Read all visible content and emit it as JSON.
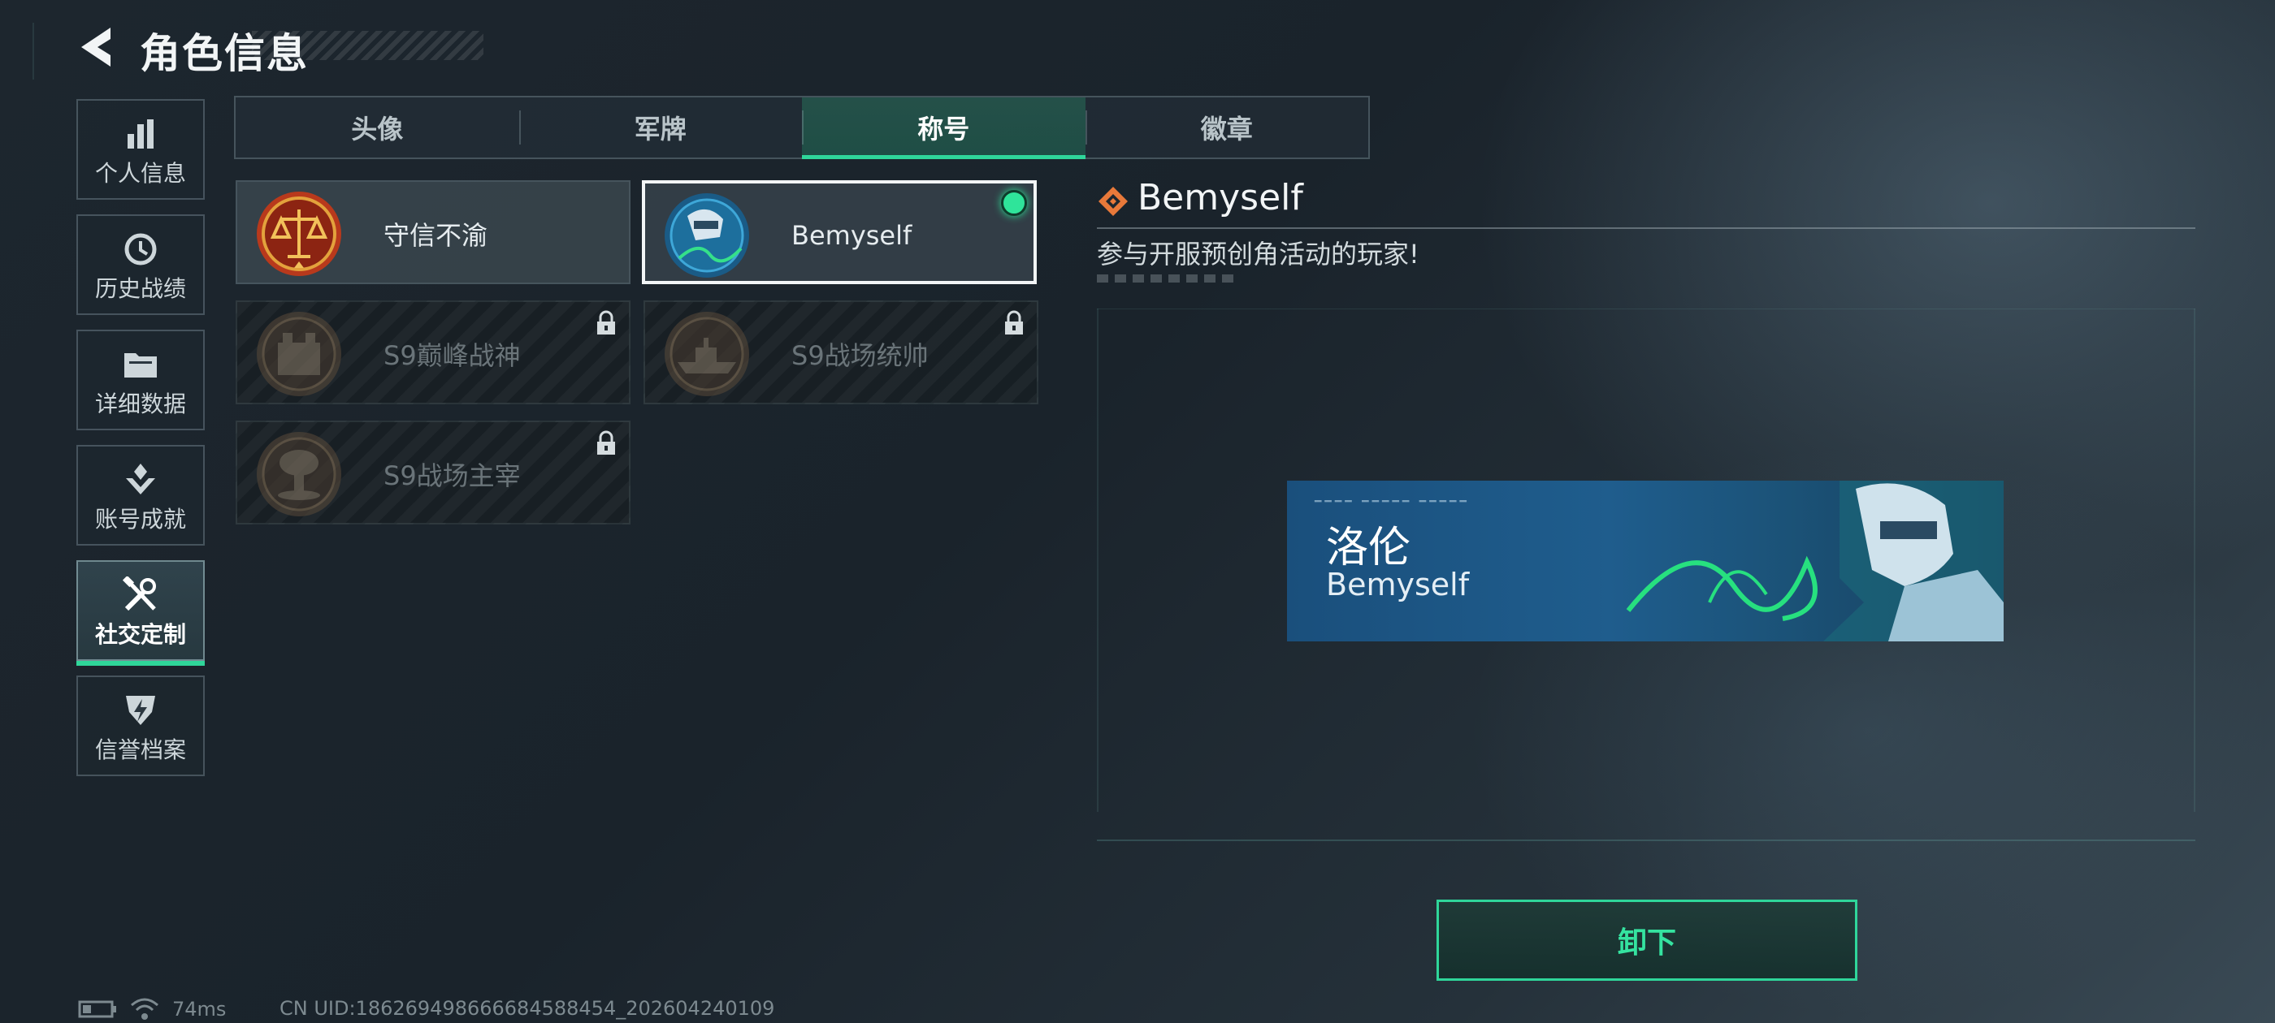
{
  "header": {
    "title": "角色信息"
  },
  "sidebar": {
    "items": [
      {
        "label": "个人信息",
        "icon": "bar-chart-icon",
        "active": false
      },
      {
        "label": "历史战绩",
        "icon": "history-clock-icon",
        "active": false
      },
      {
        "label": "详细数据",
        "icon": "folder-icon",
        "active": false
      },
      {
        "label": "账号成就",
        "icon": "achievement-icon",
        "active": false
      },
      {
        "label": "社交定制",
        "icon": "tools-icon",
        "active": true
      },
      {
        "label": "信誉档案",
        "icon": "shield-bolt-icon",
        "active": false
      }
    ]
  },
  "tabs": [
    {
      "label": "头像",
      "active": false
    },
    {
      "label": "军牌",
      "active": false
    },
    {
      "label": "称号",
      "active": true
    },
    {
      "label": "徽章",
      "active": false
    }
  ],
  "titles": [
    {
      "name": "守信不渝",
      "locked": false,
      "selected": false,
      "equipped": false,
      "icon": "scales-badge-icon"
    },
    {
      "name": "Bemyself",
      "locked": false,
      "selected": true,
      "equipped": true,
      "icon": "soldier-signature-badge-icon"
    },
    {
      "name": "S9巅峰战神",
      "locked": true,
      "selected": false,
      "equipped": false,
      "icon": "fortress-badge-icon"
    },
    {
      "name": "S9战场统帅",
      "locked": true,
      "selected": false,
      "equipped": false,
      "icon": "warship-badge-icon"
    },
    {
      "name": "S9战场主宰",
      "locked": true,
      "selected": false,
      "equipped": false,
      "icon": "mushroom-cloud-badge-icon"
    }
  ],
  "detail": {
    "title": "Bemyself",
    "description": "参与开服预创角活动的玩家!",
    "icon": "diamond-tag-icon"
  },
  "preview": {
    "nickname": "洛伦",
    "title": "Bemyself"
  },
  "action": {
    "label": "卸下"
  },
  "status": {
    "latency": "74ms",
    "uid": "CN UID:1862694986666845884​54_202604240109"
  },
  "colors": {
    "accent": "#2fd69a",
    "equipped_dot": "#2fe49a",
    "detail_icon": "#e8793a",
    "banner_blue": "#1f5d8d"
  }
}
